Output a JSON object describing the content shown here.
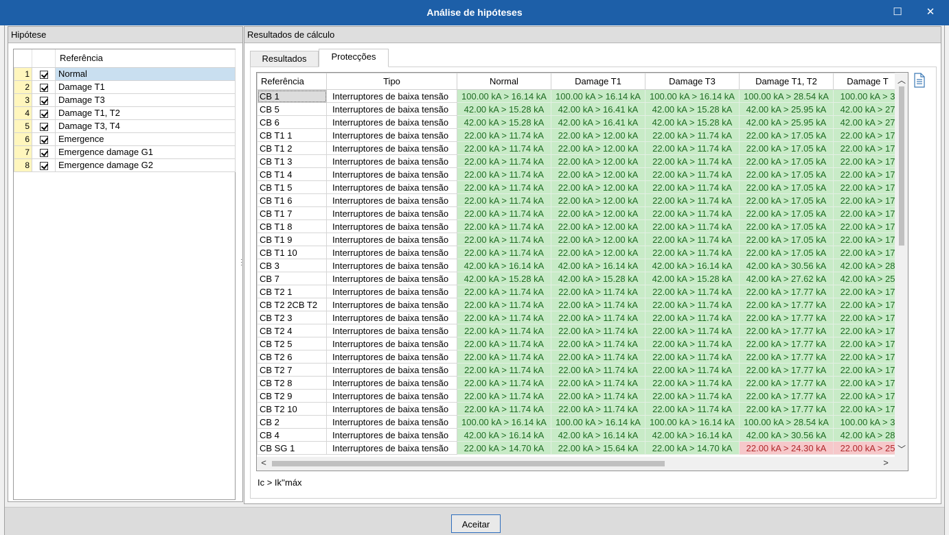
{
  "window": {
    "title": "Análise de hipóteses",
    "maximize_icon": "☐",
    "close_icon": "✕"
  },
  "hypothesis_panel": {
    "title": "Hipótese",
    "column_header": "Referência",
    "items": [
      {
        "num": "1",
        "label": "Normal"
      },
      {
        "num": "2",
        "label": "Damage T1"
      },
      {
        "num": "3",
        "label": "Damage T3"
      },
      {
        "num": "4",
        "label": "Damage T1, T2"
      },
      {
        "num": "5",
        "label": "Damage T3, T4"
      },
      {
        "num": "6",
        "label": "Emergence"
      },
      {
        "num": "7",
        "label": "Emergence damage G1"
      },
      {
        "num": "8",
        "label": "Emergence damage G2"
      }
    ]
  },
  "results_panel": {
    "title": "Resultados de cálculo",
    "tabs": [
      {
        "label": "Resultados"
      },
      {
        "label": "Protecções"
      }
    ],
    "legend": "Ic > Ik''máx",
    "columns": [
      "Referência",
      "Tipo",
      "Normal",
      "Damage T1",
      "Damage T3",
      "Damage T1, T2",
      "Damage T"
    ],
    "rows": [
      {
        "ref": "CB 1",
        "tipo": "Interruptores de baixa tensão",
        "vals": [
          "100.00 kA > 16.14 kA",
          "100.00 kA > 16.14 kA",
          "100.00 kA > 16.14 kA",
          "100.00 kA > 28.54 kA",
          "100.00 kA > 3"
        ]
      },
      {
        "ref": "CB 5",
        "tipo": "Interruptores de baixa tensão",
        "vals": [
          "42.00 kA > 15.28 kA",
          "42.00 kA > 16.41 kA",
          "42.00 kA > 15.28 kA",
          "42.00 kA > 25.95 kA",
          "42.00 kA > 27"
        ]
      },
      {
        "ref": "CB 6",
        "tipo": "Interruptores de baixa tensão",
        "vals": [
          "42.00 kA > 15.28 kA",
          "42.00 kA > 16.41 kA",
          "42.00 kA > 15.28 kA",
          "42.00 kA > 25.95 kA",
          "42.00 kA > 27"
        ]
      },
      {
        "ref": "CB T1 1",
        "tipo": "Interruptores de baixa tensão",
        "vals": [
          "22.00 kA > 11.74 kA",
          "22.00 kA > 12.00 kA",
          "22.00 kA > 11.74 kA",
          "22.00 kA > 17.05 kA",
          "22.00 kA > 17"
        ]
      },
      {
        "ref": "CB T1 2",
        "tipo": "Interruptores de baixa tensão",
        "vals": [
          "22.00 kA > 11.74 kA",
          "22.00 kA > 12.00 kA",
          "22.00 kA > 11.74 kA",
          "22.00 kA > 17.05 kA",
          "22.00 kA > 17"
        ]
      },
      {
        "ref": "CB T1 3",
        "tipo": "Interruptores de baixa tensão",
        "vals": [
          "22.00 kA > 11.74 kA",
          "22.00 kA > 12.00 kA",
          "22.00 kA > 11.74 kA",
          "22.00 kA > 17.05 kA",
          "22.00 kA > 17"
        ]
      },
      {
        "ref": "CB T1 4",
        "tipo": "Interruptores de baixa tensão",
        "vals": [
          "22.00 kA > 11.74 kA",
          "22.00 kA > 12.00 kA",
          "22.00 kA > 11.74 kA",
          "22.00 kA > 17.05 kA",
          "22.00 kA > 17"
        ]
      },
      {
        "ref": "CB T1 5",
        "tipo": "Interruptores de baixa tensão",
        "vals": [
          "22.00 kA > 11.74 kA",
          "22.00 kA > 12.00 kA",
          "22.00 kA > 11.74 kA",
          "22.00 kA > 17.05 kA",
          "22.00 kA > 17"
        ]
      },
      {
        "ref": "CB T1 6",
        "tipo": "Interruptores de baixa tensão",
        "vals": [
          "22.00 kA > 11.74 kA",
          "22.00 kA > 12.00 kA",
          "22.00 kA > 11.74 kA",
          "22.00 kA > 17.05 kA",
          "22.00 kA > 17"
        ]
      },
      {
        "ref": "CB T1 7",
        "tipo": "Interruptores de baixa tensão",
        "vals": [
          "22.00 kA > 11.74 kA",
          "22.00 kA > 12.00 kA",
          "22.00 kA > 11.74 kA",
          "22.00 kA > 17.05 kA",
          "22.00 kA > 17"
        ]
      },
      {
        "ref": "CB T1 8",
        "tipo": "Interruptores de baixa tensão",
        "vals": [
          "22.00 kA > 11.74 kA",
          "22.00 kA > 12.00 kA",
          "22.00 kA > 11.74 kA",
          "22.00 kA > 17.05 kA",
          "22.00 kA > 17"
        ]
      },
      {
        "ref": "CB T1 9",
        "tipo": "Interruptores de baixa tensão",
        "vals": [
          "22.00 kA > 11.74 kA",
          "22.00 kA > 12.00 kA",
          "22.00 kA > 11.74 kA",
          "22.00 kA > 17.05 kA",
          "22.00 kA > 17"
        ]
      },
      {
        "ref": "CB T1 10",
        "tipo": "Interruptores de baixa tensão",
        "vals": [
          "22.00 kA > 11.74 kA",
          "22.00 kA > 12.00 kA",
          "22.00 kA > 11.74 kA",
          "22.00 kA > 17.05 kA",
          "22.00 kA > 17"
        ]
      },
      {
        "ref": "CB 3",
        "tipo": "Interruptores de baixa tensão",
        "vals": [
          "42.00 kA > 16.14 kA",
          "42.00 kA > 16.14 kA",
          "42.00 kA > 16.14 kA",
          "42.00 kA > 30.56 kA",
          "42.00 kA > 28"
        ]
      },
      {
        "ref": "CB 7",
        "tipo": "Interruptores de baixa tensão",
        "vals": [
          "42.00 kA > 15.28 kA",
          "42.00 kA > 15.28 kA",
          "42.00 kA > 15.28 kA",
          "42.00 kA > 27.62 kA",
          "42.00 kA > 25"
        ]
      },
      {
        "ref": "CB T2 1",
        "tipo": "Interruptores de baixa tensão",
        "vals": [
          "22.00 kA > 11.74 kA",
          "22.00 kA > 11.74 kA",
          "22.00 kA > 11.74 kA",
          "22.00 kA > 17.77 kA",
          "22.00 kA > 17"
        ]
      },
      {
        "ref": "CB T2 2CB T2",
        "tipo": "Interruptores de baixa tensão",
        "vals": [
          "22.00 kA > 11.74 kA",
          "22.00 kA > 11.74 kA",
          "22.00 kA > 11.74 kA",
          "22.00 kA > 17.77 kA",
          "22.00 kA > 17"
        ]
      },
      {
        "ref": "CB T2 3",
        "tipo": "Interruptores de baixa tensão",
        "vals": [
          "22.00 kA > 11.74 kA",
          "22.00 kA > 11.74 kA",
          "22.00 kA > 11.74 kA",
          "22.00 kA > 17.77 kA",
          "22.00 kA > 17"
        ]
      },
      {
        "ref": "CB T2 4",
        "tipo": "Interruptores de baixa tensão",
        "vals": [
          "22.00 kA > 11.74 kA",
          "22.00 kA > 11.74 kA",
          "22.00 kA > 11.74 kA",
          "22.00 kA > 17.77 kA",
          "22.00 kA > 17"
        ]
      },
      {
        "ref": "CB T2 5",
        "tipo": "Interruptores de baixa tensão",
        "vals": [
          "22.00 kA > 11.74 kA",
          "22.00 kA > 11.74 kA",
          "22.00 kA > 11.74 kA",
          "22.00 kA > 17.77 kA",
          "22.00 kA > 17"
        ]
      },
      {
        "ref": "CB T2 6",
        "tipo": "Interruptores de baixa tensão",
        "vals": [
          "22.00 kA > 11.74 kA",
          "22.00 kA > 11.74 kA",
          "22.00 kA > 11.74 kA",
          "22.00 kA > 17.77 kA",
          "22.00 kA > 17"
        ]
      },
      {
        "ref": "CB T2 7",
        "tipo": "Interruptores de baixa tensão",
        "vals": [
          "22.00 kA > 11.74 kA",
          "22.00 kA > 11.74 kA",
          "22.00 kA > 11.74 kA",
          "22.00 kA > 17.77 kA",
          "22.00 kA > 17"
        ]
      },
      {
        "ref": "CB T2 8",
        "tipo": "Interruptores de baixa tensão",
        "vals": [
          "22.00 kA > 11.74 kA",
          "22.00 kA > 11.74 kA",
          "22.00 kA > 11.74 kA",
          "22.00 kA > 17.77 kA",
          "22.00 kA > 17"
        ]
      },
      {
        "ref": "CB T2 9",
        "tipo": "Interruptores de baixa tensão",
        "vals": [
          "22.00 kA > 11.74 kA",
          "22.00 kA > 11.74 kA",
          "22.00 kA > 11.74 kA",
          "22.00 kA > 17.77 kA",
          "22.00 kA > 17"
        ]
      },
      {
        "ref": "CB T2 10",
        "tipo": "Interruptores de baixa tensão",
        "vals": [
          "22.00 kA > 11.74 kA",
          "22.00 kA > 11.74 kA",
          "22.00 kA > 11.74 kA",
          "22.00 kA > 17.77 kA",
          "22.00 kA > 17"
        ]
      },
      {
        "ref": "CB 2",
        "tipo": "Interruptores de baixa tensão",
        "vals": [
          "100.00 kA > 16.14 kA",
          "100.00 kA > 16.14 kA",
          "100.00 kA > 16.14 kA",
          "100.00 kA > 28.54 kA",
          "100.00 kA > 3"
        ]
      },
      {
        "ref": "CB 4",
        "tipo": "Interruptores de baixa tensão",
        "vals": [
          "42.00 kA > 16.14 kA",
          "42.00 kA > 16.14 kA",
          "42.00 kA > 16.14 kA",
          "42.00 kA > 30.56 kA",
          "42.00 kA > 28"
        ]
      },
      {
        "ref": "CB SG 1",
        "tipo": "Interruptores de baixa tensão",
        "vals": [
          "22.00 kA > 14.70 kA",
          "22.00 kA > 15.64 kA",
          "22.00 kA > 14.70 kA",
          "22.00 kA > 24.30 kA",
          "22.00 kA > 25"
        ],
        "bad": [
          false,
          false,
          false,
          true,
          true
        ]
      }
    ]
  },
  "footer": {
    "ok_label": "Aceitar"
  }
}
